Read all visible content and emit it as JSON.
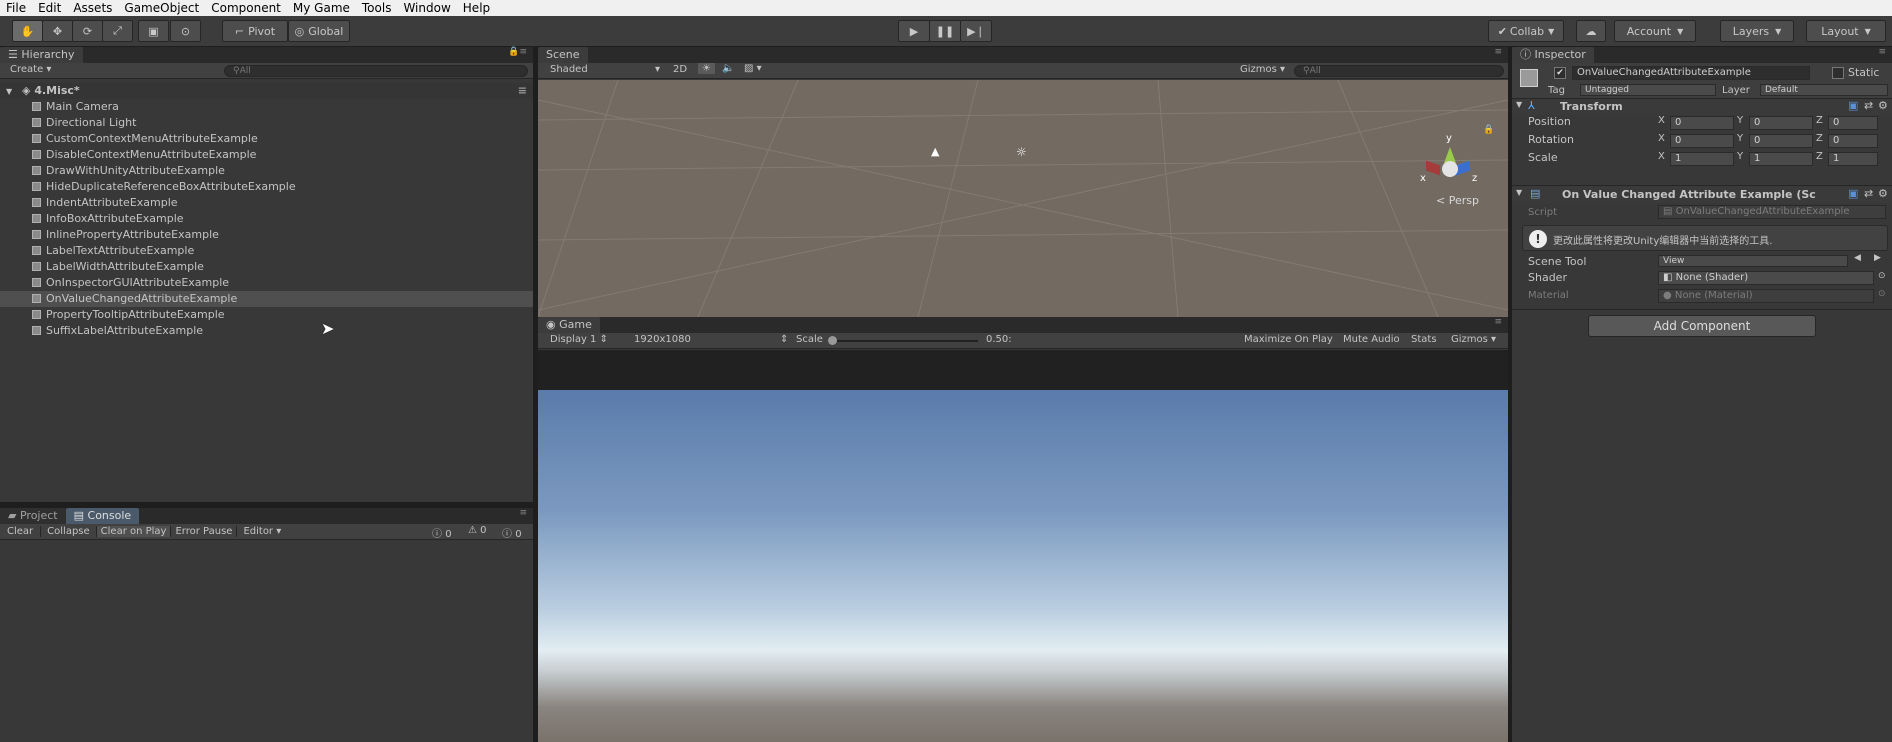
{
  "menu": [
    "File",
    "Edit",
    "Assets",
    "GameObject",
    "Component",
    "My Game",
    "Tools",
    "Window",
    "Help"
  ],
  "toolbar": {
    "pivot": "Pivot",
    "global": "Global",
    "collab": "Collab",
    "account": "Account",
    "layers": "Layers",
    "layout": "Layout"
  },
  "hierarchy": {
    "tab": "Hierarchy",
    "create": "Create",
    "search": "All",
    "scene": "4.Misc*",
    "selected_index": 12,
    "items": [
      "Main Camera",
      "Directional Light",
      "CustomContextMenuAttributeExample",
      "DisableContextMenuAttributeExample",
      "DrawWithUnityAttributeExample",
      "HideDuplicateReferenceBoxAttributeExample",
      "IndentAttributeExample",
      "InfoBoxAttributeExample",
      "InlinePropertyAttributeExample",
      "LabelTextAttributeExample",
      "LabelWidthAttributeExample",
      "OnInspectorGUIAttributeExample",
      "OnValueChangedAttributeExample",
      "PropertyTooltipAttributeExample",
      "SuffixLabelAttributeExample"
    ]
  },
  "console": {
    "tab_project": "Project",
    "tab_console": "Console",
    "clear": "Clear",
    "collapse": "Collapse",
    "clear_on_play": "Clear on Play",
    "error_pause": "Error Pause",
    "editor": "Editor",
    "count_errors": "0",
    "count_warnings": "0",
    "count_logs": "0"
  },
  "scene": {
    "tab": "Scene",
    "shading": "Shaded",
    "mode2d": "2D",
    "gizmos": "Gizmos",
    "search": "All",
    "persp": "Persp",
    "axis_y": "y",
    "axis_x": "x",
    "axis_z": "z"
  },
  "game": {
    "tab": "Game",
    "display": "Display 1",
    "resolution": "1920x1080",
    "scale_label": "Scale",
    "scale_value": "0.50:",
    "maximize": "Maximize On Play",
    "mute": "Mute Audio",
    "stats": "Stats",
    "gizmos": "Gizmos"
  },
  "inspector": {
    "tab": "Inspector",
    "object_name": "OnValueChangedAttributeExample",
    "static": "Static",
    "tag_label": "Tag",
    "tag": "Untagged",
    "layer_label": "Layer",
    "layer": "Default",
    "transform": "Transform",
    "position": "Position",
    "rotation": "Rotation",
    "scale": "Scale",
    "pos": [
      "0",
      "0",
      "0"
    ],
    "rot": [
      "0",
      "0",
      "0"
    ],
    "scl": [
      "1",
      "1",
      "1"
    ],
    "x": "X",
    "y": "Y",
    "z": "Z",
    "component": "On Value Changed Attribute Example (Sc",
    "script_label": "Script",
    "script": "OnValueChangedAttributeExample",
    "info": "更改此属性将更改Unity编辑器中当前选择的工具.",
    "scene_tool_label": "Scene Tool",
    "scene_tool": "View",
    "shader_label": "Shader",
    "shader": "None (Shader)",
    "material_label": "Material",
    "material": "None (Material)",
    "add_component": "Add Component"
  }
}
